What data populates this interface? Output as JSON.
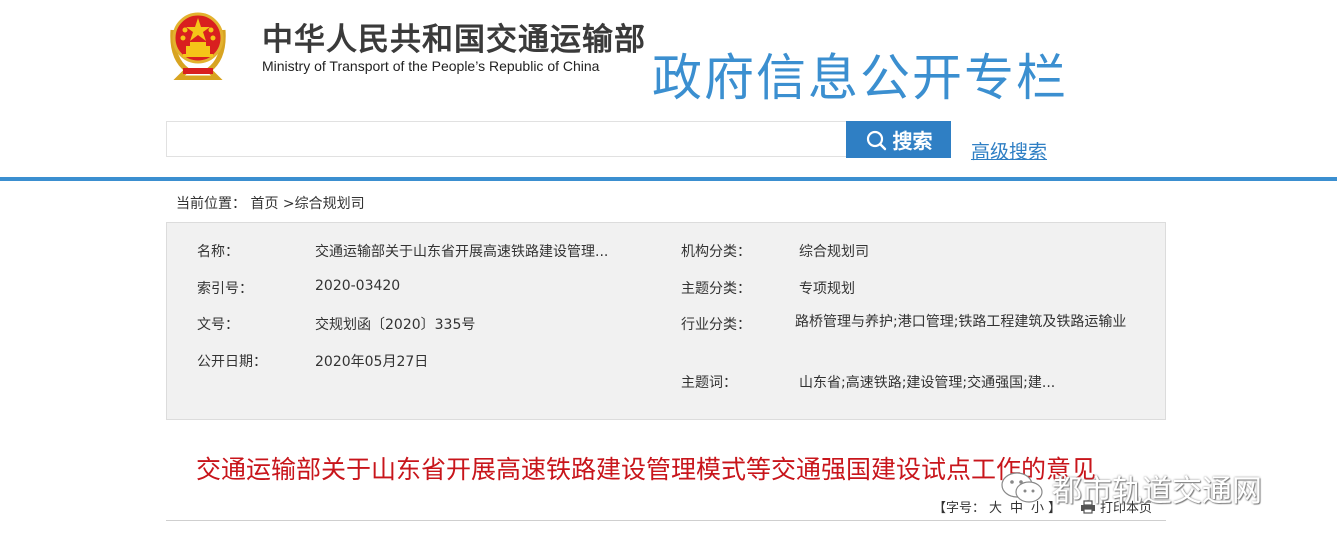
{
  "header": {
    "org_name_cn": "中华人民共和国交通运输部",
    "org_name_en": "Ministry of Transport of the People’s Republic of China",
    "column_title": "政府信息公开专栏"
  },
  "search": {
    "placeholder": "",
    "button_label": "搜索",
    "advanced_label": "高级搜索"
  },
  "breadcrumb": {
    "prefix": "当前位置：",
    "home": "首页",
    "separator": ">",
    "current": "综合规划司"
  },
  "meta": {
    "name_label": "名称：",
    "name_value": "交通运输部关于山东省开展高速铁路建设管理...",
    "index_label": "索引号：",
    "index_value": "2020-03420",
    "docno_label": "文号：",
    "docno_value": "交规划函〔2020〕335号",
    "date_label": "公开日期：",
    "date_value": "2020年05月27日",
    "agency_label": "机构分类：",
    "agency_value": "综合规划司",
    "topic_label": "主题分类：",
    "topic_value": "专项规划",
    "industry_label": "行业分类：",
    "industry_value": "路桥管理与养护;港口管理;铁路工程建筑及铁路运输业",
    "keywords_label": "主题词：",
    "keywords_value": "山东省;高速铁路;建设管理;交通强国;建..."
  },
  "document": {
    "title": "交通运输部关于山东省开展高速铁路建设管理模式等交通强国建设试点工作的意见"
  },
  "font_size_bar": {
    "open": "【字号：",
    "large": "大",
    "medium": "中",
    "small": "小",
    "close": "】",
    "print_label": "打印本页"
  },
  "watermark": {
    "text": "都市轨道交通网"
  },
  "colors": {
    "accent": "#3b8fd0",
    "search_button": "#2f7fc4",
    "title_red": "#c8151b",
    "panel_bg": "#f1f1f1"
  },
  "icons": [
    "national-emblem-icon",
    "search-icon",
    "printer-icon",
    "wechat-icon"
  ]
}
